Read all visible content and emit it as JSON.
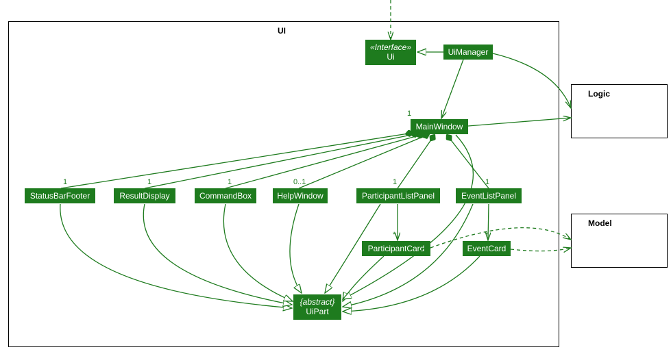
{
  "packages": {
    "ui": {
      "label": "UI"
    },
    "logic": {
      "label": "Logic"
    },
    "model": {
      "label": "Model"
    }
  },
  "classes": {
    "ui_interface": {
      "stereo": "«Interface»",
      "name": "Ui"
    },
    "ui_manager": {
      "name": "UiManager"
    },
    "main_window": {
      "name": "MainWindow"
    },
    "statusbar_footer": {
      "name": "StatusBarFooter"
    },
    "result_display": {
      "name": "ResultDisplay"
    },
    "command_box": {
      "name": "CommandBox"
    },
    "help_window": {
      "name": "HelpWindow"
    },
    "participant_list_panel": {
      "name": "ParticipantListPanel"
    },
    "event_list_panel": {
      "name": "EventListPanel"
    },
    "participant_card": {
      "name": "ParticipantCard"
    },
    "event_card": {
      "name": "EventCard"
    },
    "ui_part": {
      "stereo": "{abstract}",
      "name": "UiPart"
    }
  },
  "multiplicities": {
    "main_window": "1",
    "statusbar_footer": "1",
    "result_display": "1",
    "command_box": "1",
    "help_window": "0..1",
    "participant_list_panel": "1",
    "event_list_panel": "1",
    "participant_card": "*",
    "event_card": "*"
  },
  "colors": {
    "green": "#1e7b1e"
  }
}
